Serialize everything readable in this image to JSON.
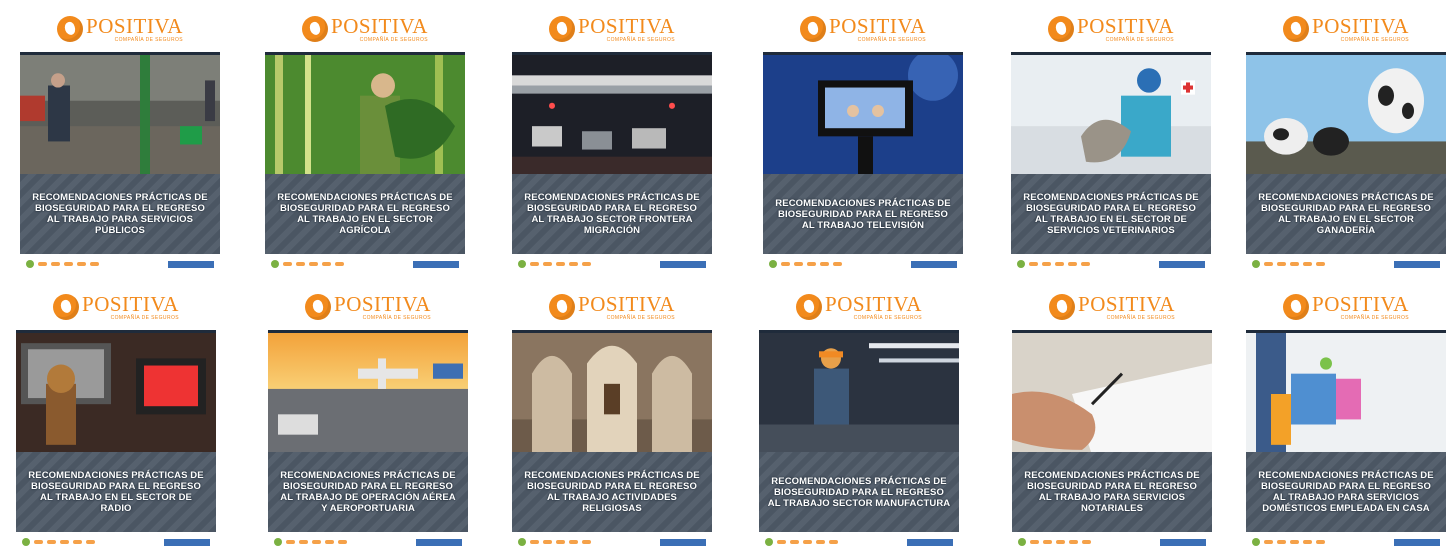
{
  "brand": {
    "name": "POSITIVA",
    "tagline": "COMPAÑÍA DE SEGUROS"
  },
  "cards": [
    {
      "title": "RECOMENDACIONES PRÁCTICAS DE BIOSEGURIDAD PARA EL REGRESO AL TRABAJO PARA SERVICIOS PÚBLICOS"
    },
    {
      "title": "RECOMENDACIONES PRÁCTICAS DE BIOSEGURIDAD PARA EL REGRESO AL TRABAJO EN EL SECTOR AGRÍCOLA"
    },
    {
      "title": "RECOMENDACIONES PRÁCTICAS DE BIOSEGURIDAD PARA EL REGRESO AL TRABAJO SECTOR FRONTERA MIGRACIÓN"
    },
    {
      "title": "RECOMENDACIONES PRÁCTICAS DE BIOSEGURIDAD PARA EL REGRESO AL TRABAJO TELEVISIÓN"
    },
    {
      "title": "RECOMENDACIONES PRÁCTICAS DE BIOSEGURIDAD PARA EL REGRESO AL TRABAJO EN EL SECTOR DE SERVICIOS VETERINARIOS"
    },
    {
      "title": "RECOMENDACIONES PRÁCTICAS DE BIOSEGURIDAD PARA EL REGRESO AL TRABAJO EN EL SECTOR GANADERÍA"
    },
    {
      "title": "RECOMENDACIONES PRÁCTICAS DE BIOSEGURIDAD PARA EL REGRESO AL TRABAJO EN EL SECTOR DE RADIO"
    },
    {
      "title": "RECOMENDACIONES PRÁCTICAS DE BIOSEGURIDAD PARA EL REGRESO AL TRABAJO DE OPERACIÓN AÉREA Y AEROPORTUARIA"
    },
    {
      "title": "RECOMENDACIONES PRÁCTICAS DE BIOSEGURIDAD PARA EL REGRESO AL TRABAJO ACTIVIDADES RELIGIOSAS"
    },
    {
      "title": "RECOMENDACIONES PRÁCTICAS DE BIOSEGURIDAD PARA EL REGRESO AL TRABAJO SECTOR MANUFACTURA"
    },
    {
      "title": "RECOMENDACIONES PRÁCTICAS DE BIOSEGURIDAD PARA EL REGRESO AL TRABAJO PARA SERVICIOS NOTARIALES"
    },
    {
      "title": "RECOMENDACIONES PRÁCTICAS DE BIOSEGURIDAD PARA EL REGRESO AL TRABAJO PARA SERVICIOS DOMÉSTICOS EMPLEADA EN CASA"
    }
  ],
  "colors": {
    "brand_orange": "#f28a1c",
    "band_gray": "#4b5663",
    "footer_blue": "#3b6fb6"
  },
  "photos": [
    "utility-worker",
    "farm-worker",
    "border-crossing",
    "tv-camera",
    "veterinary",
    "cattle",
    "radio-studio",
    "airport",
    "church",
    "manufacturing",
    "notary-signing",
    "housekeeping"
  ]
}
